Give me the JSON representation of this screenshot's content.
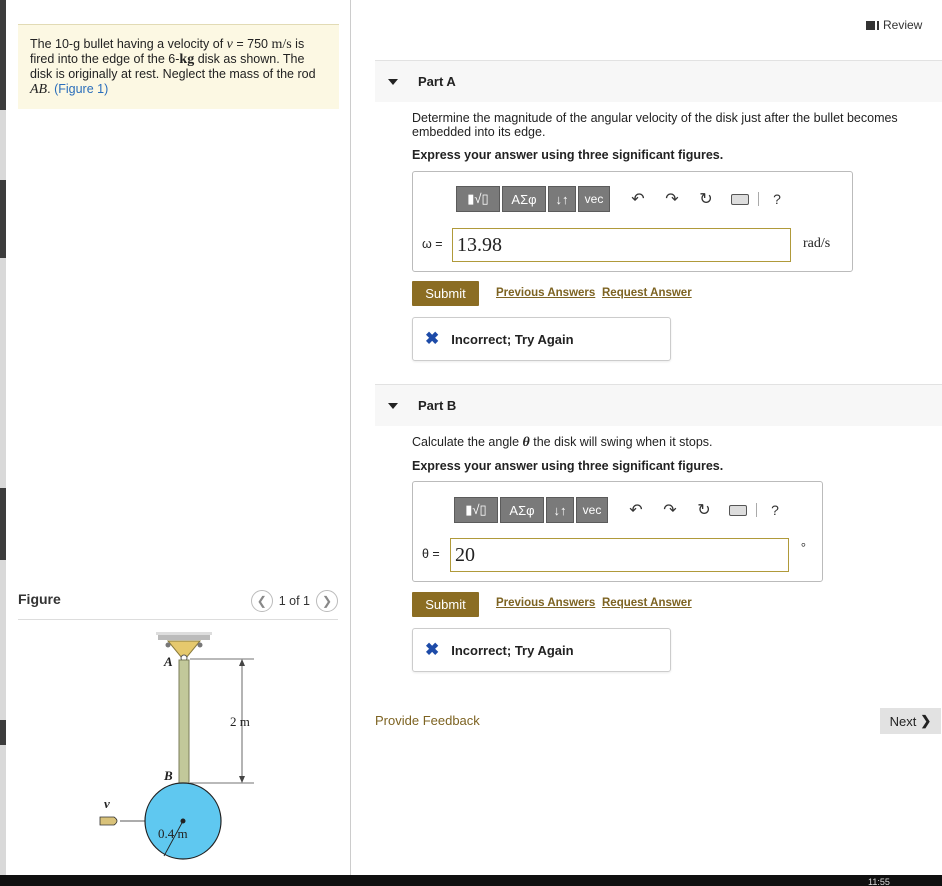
{
  "problem": {
    "text_1": "The 10-g bullet having a velocity of ",
    "v": "v",
    "eq": " = 750 ",
    "units_ms": "m/s",
    "text_2": " is fired into the edge of the 6-",
    "kg": "kg",
    "text_3": " disk as shown. The disk is originally at rest. Neglect the mass of the rod ",
    "ab": "AB",
    "text_4": ". ",
    "figure_link": "(Figure 1)"
  },
  "figure": {
    "title": "Figure",
    "pager": "1 of 1",
    "label_A": "A",
    "label_B": "B",
    "label_v": "v",
    "dim_length": "2 m",
    "dim_radius": "0.4 m"
  },
  "review": "Review",
  "part_a": {
    "title": "Part A",
    "question": "Determine the magnitude of the angular velocity of the disk just after the bullet becomes embedded into its edge.",
    "instruction": "Express your answer using three significant figures.",
    "var_label": "ω =",
    "value": "13.98",
    "unit": "rad/s",
    "submit": "Submit",
    "previous_answers": "Previous Answers",
    "request_answer": "Request Answer",
    "feedback": "Incorrect; Try Again"
  },
  "part_b": {
    "title": "Part B",
    "question_1": "Calculate the angle ",
    "theta": "θ",
    "question_2": " the disk will swing when it stops.",
    "instruction": "Express your answer using three significant figures.",
    "var_label": "θ =",
    "value": "20",
    "unit": "°",
    "submit": "Submit",
    "previous_answers": "Previous Answers",
    "request_answer": "Request Answer",
    "feedback": "Incorrect; Try Again"
  },
  "toolbar": {
    "templates": "▮√▯",
    "greek": "ΑΣφ",
    "arrows": "↓↑",
    "vec": "vec",
    "help": "?"
  },
  "provide_feedback": "Provide Feedback",
  "next": "Next",
  "clock": "11:55"
}
